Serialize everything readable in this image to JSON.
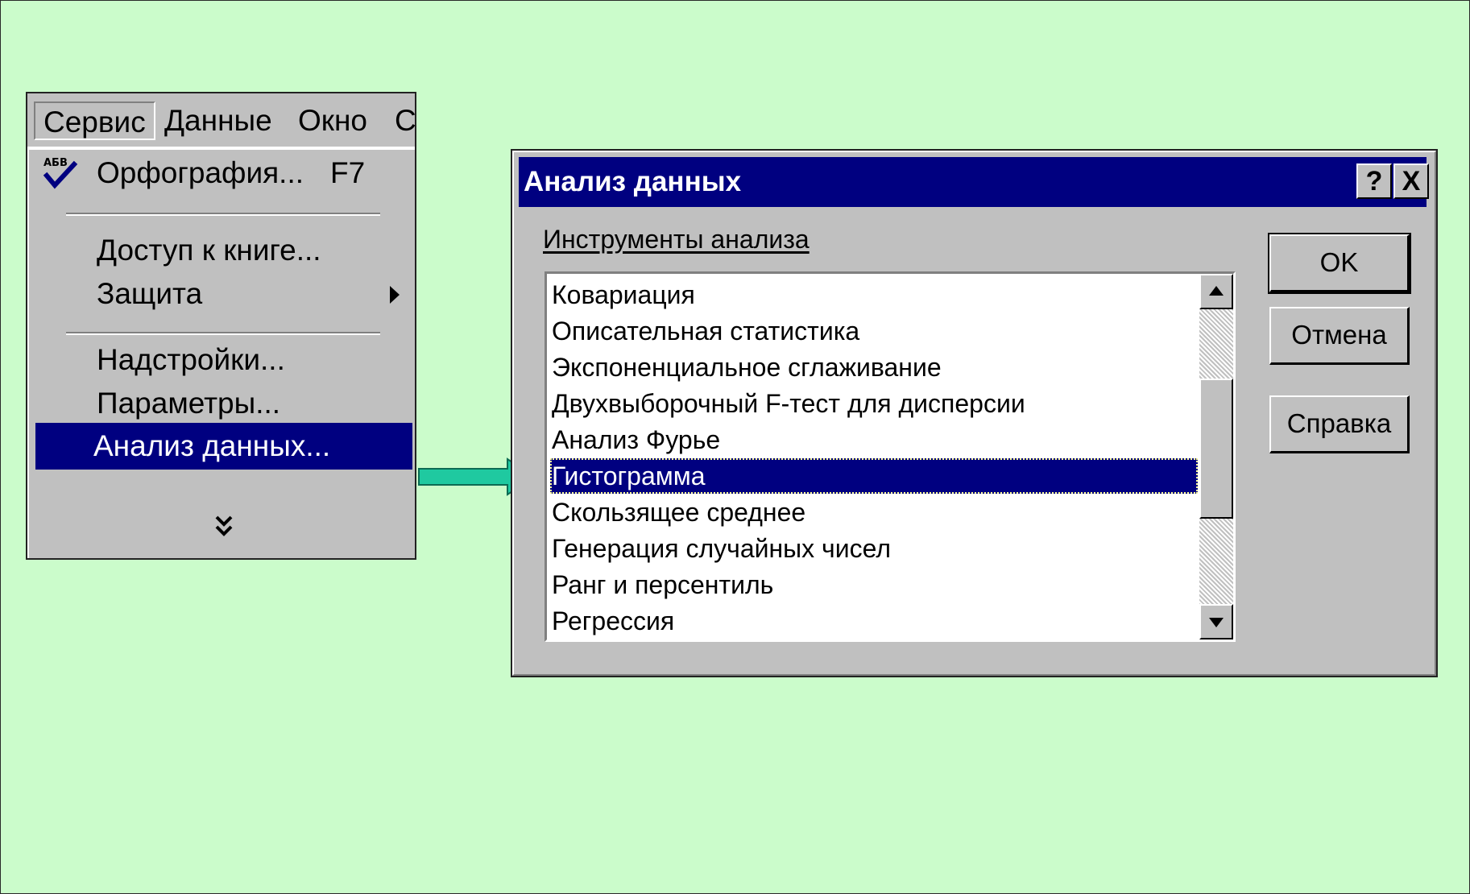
{
  "menu": {
    "menubar": [
      "Сервис",
      "Данные",
      "Окно",
      "Справка"
    ],
    "items": [
      {
        "label": "Орфография...",
        "shortcut": "F7",
        "icon": "spell-check-icon"
      },
      {
        "label": "Доступ к книге..."
      },
      {
        "label": "Защита",
        "submenu": true
      },
      {
        "label": "Надстройки..."
      },
      {
        "label": "Параметры..."
      },
      {
        "label": "Анализ данных...",
        "selected": true
      }
    ],
    "expand_icon": "double-chevron-down-icon"
  },
  "arrow": {
    "color": "#1fc9a0"
  },
  "dialog": {
    "title": "Анализ данных",
    "help_button": "?",
    "close_button": "X",
    "group_label": "Инструменты анализа",
    "tools": [
      "Ковариация",
      "Описательная статистика",
      "Экспоненциальное сглаживание",
      "Двухвыборочный F-тест для дисперсии",
      "Анализ Фурье",
      "Гистограмма",
      "Скользящее среднее",
      "Генерация случайных чисел",
      "Ранг и персентиль",
      "Регрессия"
    ],
    "selected_tool": "Гистограмма",
    "buttons": {
      "ok": "OK",
      "cancel": "Отмена",
      "help": "Справка"
    }
  },
  "colors": {
    "background": "#cbfccb",
    "titlebar": "#000080",
    "selection": "#000080",
    "window_face": "#c0c0c0"
  }
}
